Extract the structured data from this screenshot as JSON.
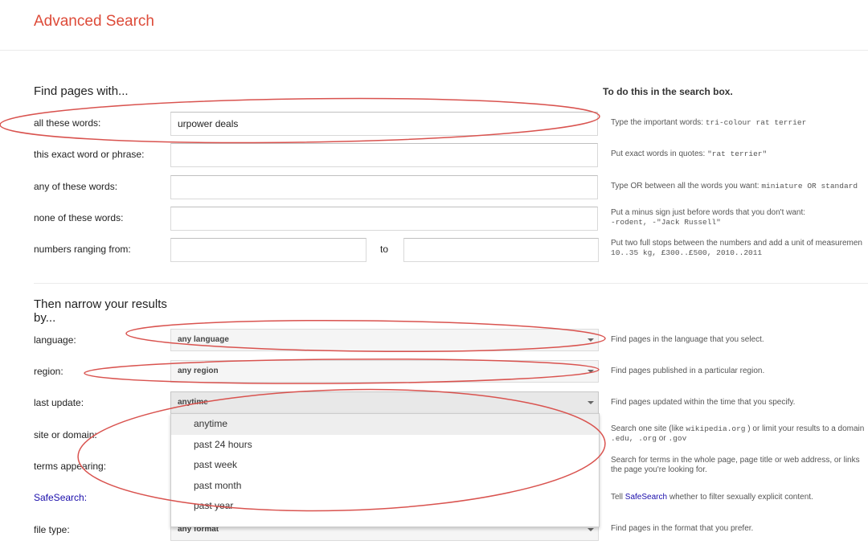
{
  "header": {
    "title": "Advanced Search"
  },
  "find": {
    "heading": "Find pages with...",
    "hint_heading": "To do this in the search box.",
    "rows": [
      {
        "label": "all these words:",
        "value": "urpower deals",
        "hint": "Type the important words: ",
        "hint_code": "tri-colour rat terrier"
      },
      {
        "label": "this exact word or phrase:",
        "value": "",
        "hint": "Put exact words in quotes: ",
        "hint_code": "\"rat terrier\""
      },
      {
        "label": "any of these words:",
        "value": "",
        "hint": "Type OR between all the words you want: ",
        "hint_code": "miniature OR standard"
      },
      {
        "label": "none of these words:",
        "value": "",
        "hint": "Put a minus sign just before words that you don't want:",
        "hint_code": "-rodent, -\"Jack Russell\""
      },
      {
        "label": "numbers ranging from:",
        "value": "",
        "to_label": "to",
        "to_value": "",
        "hint": "Put two full stops between the numbers and add a unit of measuremen",
        "hint_code": "10..35 kg, £300..£500, 2010..2011"
      }
    ]
  },
  "narrow": {
    "heading": "Then narrow your results by...",
    "rows": [
      {
        "label": "language:",
        "value": "any language",
        "hint": "Find pages in the language that you select."
      },
      {
        "label": "region:",
        "value": "any region",
        "hint": "Find pages published in a particular region."
      },
      {
        "label": "last update:",
        "value": "anytime",
        "hint": "Find pages updated within the time that you specify."
      },
      {
        "label": "site or domain:",
        "hint": "Search one site (like ",
        "hint_code": "wikipedia.org",
        "hint_rest": " ) or limit your results to a domain",
        "hint_line2_code": ".edu, .org",
        "hint_line2_mid": " or ",
        "hint_line2_code2": ".gov"
      },
      {
        "label": "terms appearing:",
        "hint": "Search for terms in the whole page, page title or web address, or links",
        "hint_line2": "the page you're looking for."
      },
      {
        "label": "SafeSearch:",
        "hint_pre": "Tell ",
        "hint_link": "SafeSearch",
        "hint_post": " whether to filter sexually explicit content."
      },
      {
        "label": "file type:",
        "value": "any format",
        "hint": "Find pages in the format that you prefer."
      }
    ],
    "last_update_options": [
      "anytime",
      "past 24 hours",
      "past week",
      "past month",
      "past year"
    ]
  },
  "colors": {
    "accent": "#dd4b39",
    "annotation": "#d9534f",
    "link": "#1a0dab"
  }
}
